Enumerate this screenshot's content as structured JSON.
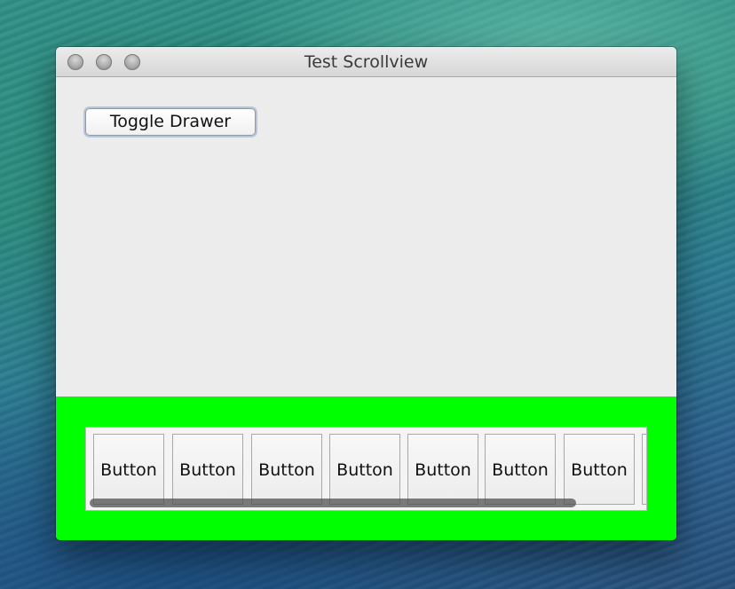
{
  "window": {
    "title": "Test Scrollview"
  },
  "content": {
    "toggle_button_label": "Toggle Drawer"
  },
  "drawer": {
    "background_color": "#00ff00",
    "buttons": [
      {
        "label": "Button"
      },
      {
        "label": "Button"
      },
      {
        "label": "Button"
      },
      {
        "label": "Button"
      },
      {
        "label": "Button"
      },
      {
        "label": "Button"
      },
      {
        "label": "Button"
      },
      {
        "label": ""
      }
    ]
  }
}
